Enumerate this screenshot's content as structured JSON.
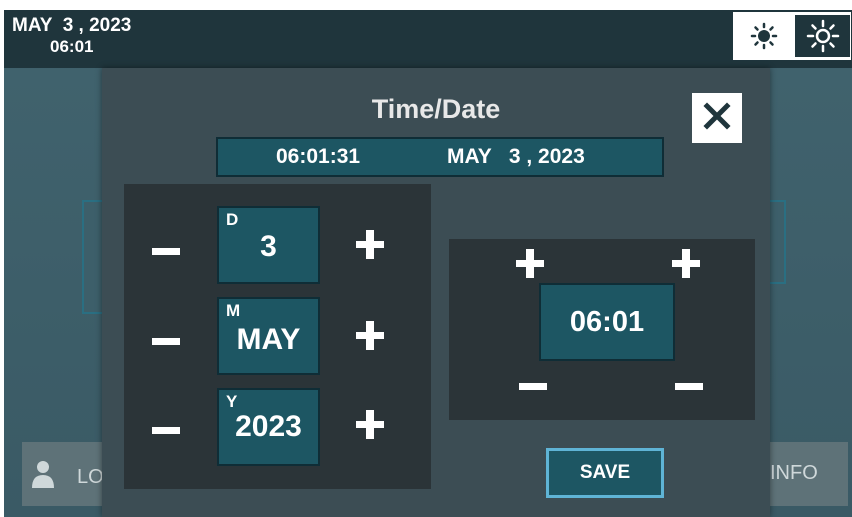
{
  "header": {
    "date": "MAY  3 , 2023",
    "time": "06:01"
  },
  "brightness": {
    "low_icon": "sun-small-icon",
    "high_icon": "sun-large-icon"
  },
  "background": {
    "login_label": "LO",
    "info_label": "INFO",
    "user_icon": "user-icon"
  },
  "dialog": {
    "title": "Time/Date",
    "close_icon": "close-icon",
    "current_time": "06:01:31",
    "current_date": "MAY   3 , 2023",
    "day": {
      "tag": "D",
      "value": "3"
    },
    "month": {
      "tag": "M",
      "value": "MAY"
    },
    "year": {
      "tag": "Y",
      "value": "2023"
    },
    "time_value": "06:01",
    "save_label": "SAVE"
  },
  "colors": {
    "panel_dark": "#2b3438",
    "field_teal": "#1d5663",
    "save_border": "#5fb4d6",
    "topbar": "#1f353c"
  }
}
